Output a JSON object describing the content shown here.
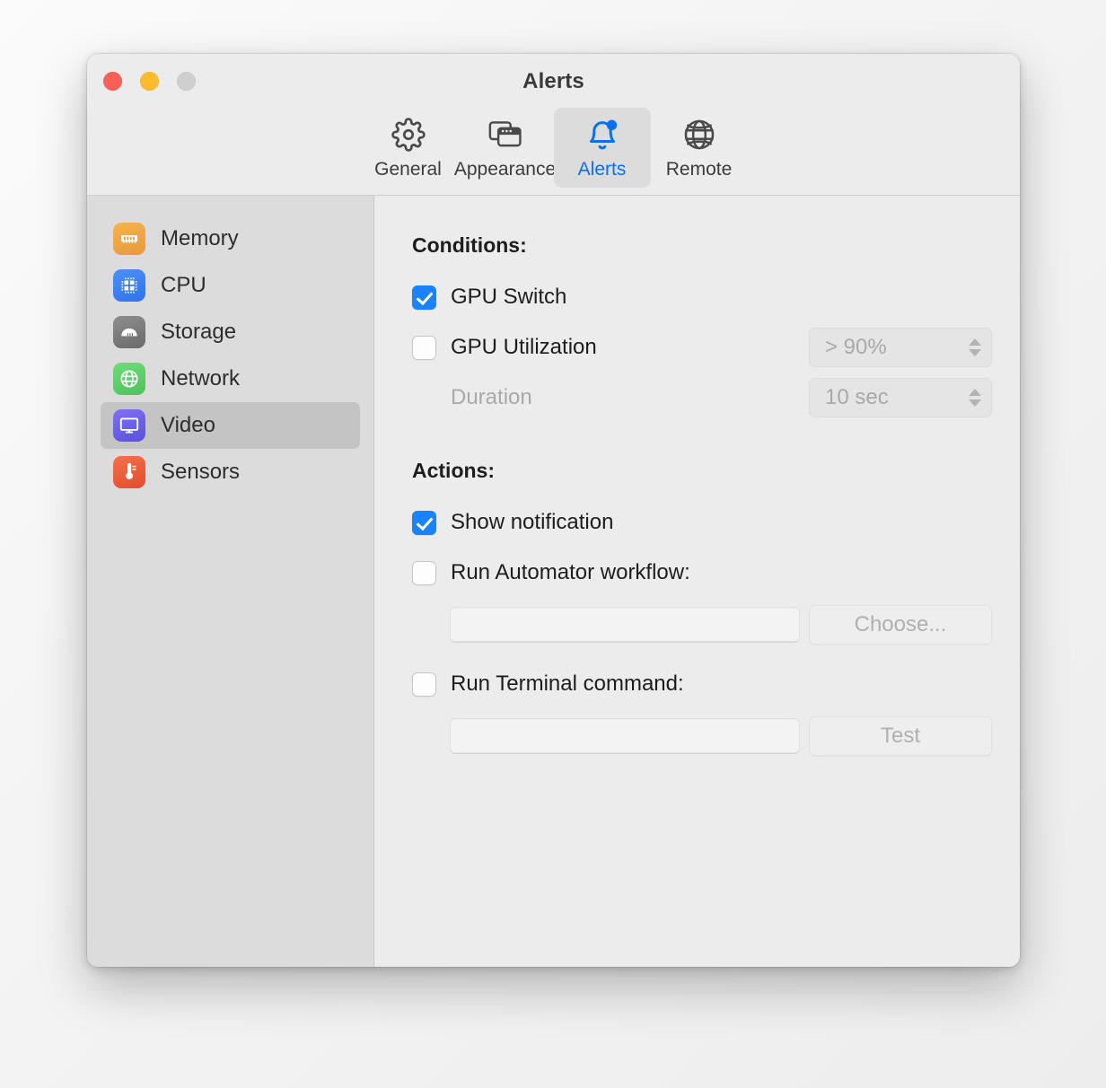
{
  "window": {
    "title": "Alerts",
    "traffic_lights": [
      {
        "name": "close",
        "color": "#fc5f57"
      },
      {
        "name": "minimize",
        "color": "#fdbc2e"
      },
      {
        "name": "zoom",
        "color": "#cfcfcf"
      }
    ]
  },
  "toolbar": {
    "tabs": [
      {
        "label": "General",
        "icon": "gear-icon",
        "selected": false
      },
      {
        "label": "Appearance",
        "icon": "windows-icon",
        "selected": false
      },
      {
        "label": "Alerts",
        "icon": "bell-badge-icon",
        "selected": true
      },
      {
        "label": "Remote",
        "icon": "globe-icon",
        "selected": false
      }
    ],
    "accent_color": "#0a70f0",
    "selected_tab_bg": "#dcdcdc"
  },
  "sidebar": {
    "items": [
      {
        "label": "Memory",
        "icon": "memory-icon",
        "color": "#f0a43a",
        "selected": false
      },
      {
        "label": "CPU",
        "icon": "cpu-icon",
        "color": "#3b82f6",
        "selected": false
      },
      {
        "label": "Storage",
        "icon": "storage-icon",
        "color": "#7d7d7d",
        "selected": false
      },
      {
        "label": "Network",
        "icon": "network-icon",
        "color": "#5ccd69",
        "selected": false
      },
      {
        "label": "Video",
        "icon": "display-icon",
        "color": "#6b61e8",
        "selected": true
      },
      {
        "label": "Sensors",
        "icon": "sensor-icon",
        "color": "#ec5836",
        "selected": false
      }
    ],
    "selected_bg": "#c4c4c4"
  },
  "main": {
    "conditions": {
      "title": "Conditions:",
      "rows": [
        {
          "label": "GPU Switch",
          "checked": true,
          "enabled": true,
          "has_combo": false
        },
        {
          "label": "GPU Utilization",
          "checked": false,
          "enabled": true,
          "has_combo": true,
          "combo_value": "> 90%"
        }
      ],
      "duration": {
        "label": "Duration",
        "value": "10 sec",
        "enabled": false
      }
    },
    "actions": {
      "title": "Actions:",
      "show_notification": {
        "label": "Show notification",
        "checked": true
      },
      "automator": {
        "label": "Run Automator workflow:",
        "checked": false,
        "field_value": "",
        "field_placeholder": "",
        "button_label": "Choose..."
      },
      "terminal": {
        "label": "Run Terminal command:",
        "checked": false,
        "field_value": "",
        "field_placeholder": "",
        "button_label": "Test"
      }
    }
  }
}
